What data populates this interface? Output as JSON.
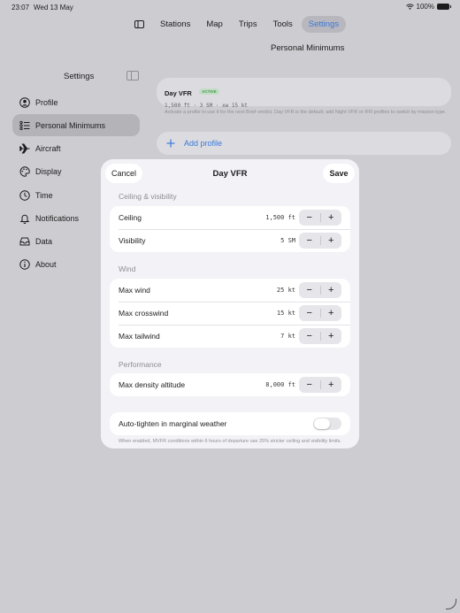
{
  "status": {
    "time": "23:07",
    "date": "Wed 13 May",
    "battery": "100%"
  },
  "tabs": [
    {
      "label": "Stations"
    },
    {
      "label": "Map"
    },
    {
      "label": "Trips"
    },
    {
      "label": "Tools"
    },
    {
      "label": "Settings",
      "active": true
    }
  ],
  "page_title": "Personal Minimums",
  "sidebar": {
    "title": "Settings",
    "items": [
      {
        "label": "Profile",
        "icon": "person-circle-icon"
      },
      {
        "label": "Personal Minimums",
        "icon": "checklist-icon",
        "active": true
      },
      {
        "label": "Aircraft",
        "icon": "airplane-icon"
      },
      {
        "label": "Display",
        "icon": "palette-icon"
      },
      {
        "label": "Time",
        "icon": "clock-icon"
      },
      {
        "label": "Notifications",
        "icon": "bell-icon"
      },
      {
        "label": "Data",
        "icon": "tray-icon"
      },
      {
        "label": "About",
        "icon": "info-icon"
      }
    ]
  },
  "main": {
    "profile": {
      "name": "Day VFR",
      "badge": "ACTIVE",
      "summary": "1,500 ft · 3 SM · xw 15 kt"
    },
    "profile_note": "Activate a profile to use it for the next Brief verdict. Day VFR is the default; add Night VFR or IFR profiles to switch by mission type.",
    "add_profile_label": "Add profile"
  },
  "sheet": {
    "cancel_label": "Cancel",
    "title": "Day VFR",
    "save_label": "Save",
    "sections": {
      "ceiling_visibility": {
        "label": "Ceiling & visibility",
        "rows": [
          {
            "label": "Ceiling",
            "value": "1,500 ft"
          },
          {
            "label": "Visibility",
            "value": "5 SM"
          }
        ]
      },
      "wind": {
        "label": "Wind",
        "rows": [
          {
            "label": "Max wind",
            "value": "25 kt"
          },
          {
            "label": "Max crosswind",
            "value": "15 kt"
          },
          {
            "label": "Max tailwind",
            "value": "7 kt"
          }
        ]
      },
      "performance": {
        "label": "Performance",
        "rows": [
          {
            "label": "Max density altitude",
            "value": "8,000 ft"
          }
        ]
      }
    },
    "auto_tighten": {
      "label": "Auto-tighten in marginal weather",
      "enabled": false
    },
    "footnote": "When enabled, MVFR conditions within 6 hours of departure use 25% stricter ceiling and visibility limits."
  },
  "stepper": {
    "minus": "−",
    "plus": "+"
  },
  "colors": {
    "accent": "#3b78d8",
    "active_badge": "#3f9a4a",
    "background": "#cdcdd1"
  }
}
